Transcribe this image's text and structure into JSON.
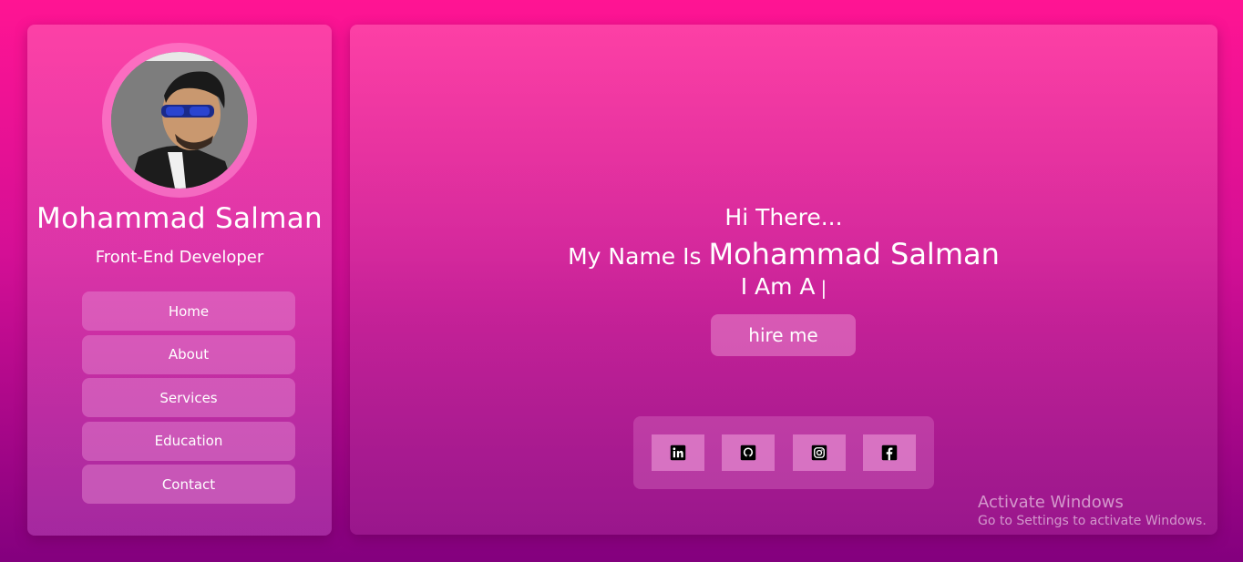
{
  "profile": {
    "name": "Mohammad Salman",
    "role": "Front-End Developer",
    "avatar_alt": "profile photo"
  },
  "nav": {
    "items": [
      {
        "label": "Home"
      },
      {
        "label": "About"
      },
      {
        "label": "Services"
      },
      {
        "label": "Education"
      },
      {
        "label": "Contact"
      }
    ]
  },
  "hero": {
    "greeting": "Hi There...",
    "intro_prefix": "My Name Is",
    "intro_name": "Mohammad Salman",
    "typed_prefix": "I Am A",
    "cursor": "|",
    "hire_label": "hire me"
  },
  "social": [
    {
      "icon": "linkedin-icon"
    },
    {
      "icon": "github-icon"
    },
    {
      "icon": "instagram-icon"
    },
    {
      "icon": "facebook-icon"
    }
  ],
  "watermark": {
    "title": "Activate Windows",
    "subtitle": "Go to Settings to activate Windows."
  }
}
